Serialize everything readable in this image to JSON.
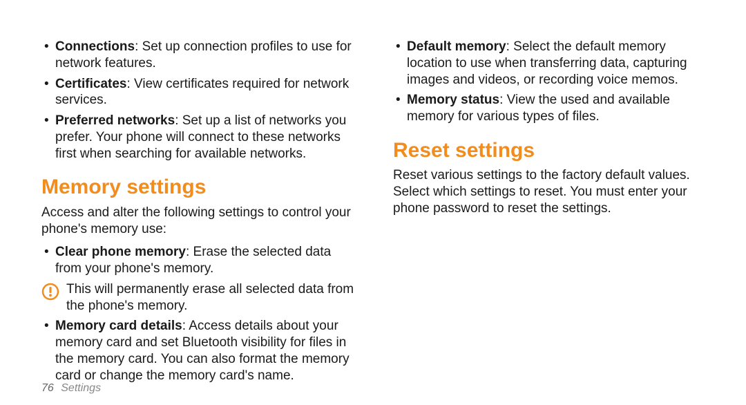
{
  "left": {
    "top_bullets": [
      {
        "title": "Connections",
        "desc": ": Set up connection profiles to use for network features."
      },
      {
        "title": "Certificates",
        "desc": ": View certificates required for network services."
      },
      {
        "title": "Preferred networks",
        "desc": ": Set up a list of networks you prefer. Your phone will connect to these networks first when searching for available networks."
      }
    ],
    "heading": "Memory settings",
    "intro": "Access and alter the following settings to control your phone's memory use:",
    "bullets": [
      {
        "title": "Clear phone memory",
        "desc": ": Erase the selected data from your phone's memory."
      }
    ],
    "warning": "This will permanently erase all selected data from the phone's memory.",
    "bullets2": [
      {
        "title": "Memory card details",
        "desc": ": Access details about your memory card and set Bluetooth visibility for files in the memory card. You can also format the memory card or change the memory card's name."
      }
    ]
  },
  "right": {
    "top_bullets": [
      {
        "title": "Default memory",
        "desc": ": Select the default memory location to use when transferring data, capturing images and videos, or recording voice memos."
      },
      {
        "title": "Memory status",
        "desc": ": View the used and available memory for various types of files."
      }
    ],
    "heading": "Reset settings",
    "intro": "Reset various settings to the factory default values. Select which settings to reset. You must enter your phone password to reset the settings."
  },
  "footer": {
    "page": "76",
    "section": "Settings"
  },
  "colors": {
    "accent": "#f28c1c"
  }
}
